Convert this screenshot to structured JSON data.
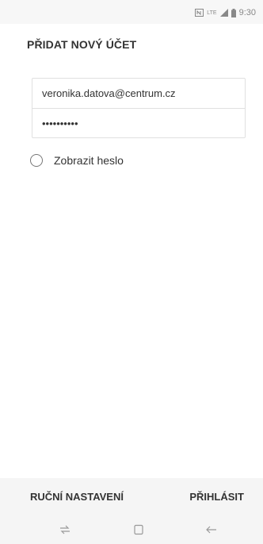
{
  "status_bar": {
    "time": "9:30",
    "network": "LTE",
    "icons": [
      "nfc-icon",
      "lte-icon",
      "signal-icon",
      "battery-icon"
    ]
  },
  "header": {
    "title": "PŘIDAT NOVÝ ÚČET"
  },
  "form": {
    "email_value": "veronika.datova@centrum.cz",
    "password_value": "••••••••••"
  },
  "show_password": {
    "label": "Zobrazit heslo",
    "checked": false
  },
  "actions": {
    "manual_label": "RUČNÍ NASTAVENÍ",
    "login_label": "PŘIHLÁSIT"
  },
  "nav_bar": {
    "icons": [
      "recent-apps-icon",
      "home-icon",
      "back-icon"
    ]
  }
}
